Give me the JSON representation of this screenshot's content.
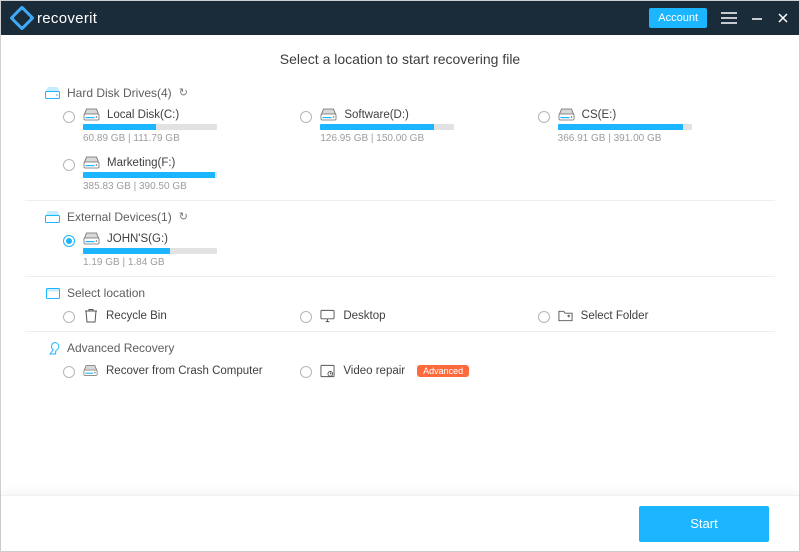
{
  "titlebar": {
    "brand": "recoverit",
    "account_label": "Account"
  },
  "page_title": "Select a location to start recovering file",
  "sections": {
    "hdd": {
      "label": "Hard Disk Drives(4)"
    },
    "ext": {
      "label": "External Devices(1)"
    },
    "loc": {
      "label": "Select location"
    },
    "adv": {
      "label": "Advanced Recovery"
    }
  },
  "drives": {
    "hdd": [
      {
        "label": "Local Disk(C:)",
        "used": 60.89,
        "total": 111.79,
        "size_text": "60.89  GB | 111.79  GB",
        "selected": false
      },
      {
        "label": "Software(D:)",
        "used": 126.95,
        "total": 150.0,
        "size_text": "126.95  GB | 150.00  GB",
        "selected": false
      },
      {
        "label": "CS(E:)",
        "used": 366.91,
        "total": 391.0,
        "size_text": "366.91  GB | 391.00  GB",
        "selected": false
      },
      {
        "label": "Marketing(F:)",
        "used": 385.83,
        "total": 390.5,
        "size_text": "385.83  GB | 390.50  GB",
        "selected": false
      }
    ],
    "ext": [
      {
        "label": "JOHN'S(G:)",
        "used": 1.19,
        "total": 1.84,
        "size_text": "1.19  GB | 1.84  GB",
        "selected": true
      }
    ]
  },
  "locations": [
    {
      "label": "Recycle Bin",
      "icon": "trash"
    },
    {
      "label": "Desktop",
      "icon": "monitor"
    },
    {
      "label": "Select Folder",
      "icon": "folder"
    }
  ],
  "advanced": [
    {
      "label": "Recover from Crash Computer",
      "icon": "disk",
      "badge": null
    },
    {
      "label": "Video repair",
      "icon": "video",
      "badge": "Advanced"
    }
  ],
  "footer": {
    "start_label": "Start"
  },
  "colors": {
    "accent": "#1cb5ff",
    "badge": "#ff6a3d",
    "titlebar": "#1a2b3a"
  }
}
